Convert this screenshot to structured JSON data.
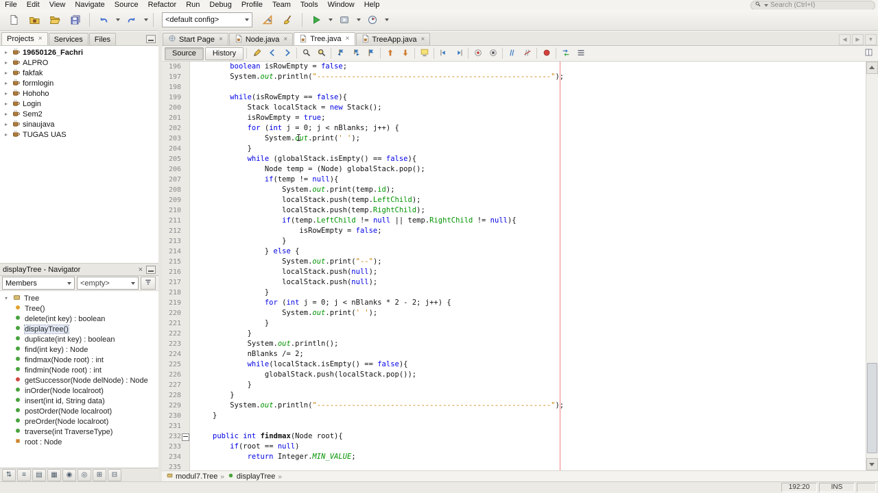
{
  "glyphs": {
    "close": "×",
    "expander_collapsed": "▸",
    "expander_expanded": "▾",
    "breadcrumb_sep": "»",
    "tab_scroll_left": "◀",
    "tab_scroll_right": "▶",
    "tab_list": "▼"
  },
  "menubar": {
    "items": [
      "File",
      "Edit",
      "View",
      "Navigate",
      "Source",
      "Refactor",
      "Run",
      "Debug",
      "Profile",
      "Team",
      "Tools",
      "Window",
      "Help"
    ],
    "search_placeholder": "Search (Ctrl+I)"
  },
  "main_toolbar": {
    "config_value": "<default config>",
    "items": [
      {
        "name": "new-file",
        "icon": "new-file"
      },
      {
        "name": "new-project",
        "icon": "new-project"
      },
      {
        "name": "open-project",
        "icon": "open-project"
      },
      {
        "name": "save-all",
        "icon": "save-all"
      },
      {
        "type": "sep"
      },
      {
        "name": "undo",
        "icon": "undo",
        "caret": true
      },
      {
        "name": "redo",
        "icon": "redo",
        "caret": true
      },
      {
        "type": "sep"
      },
      {
        "type": "config"
      },
      {
        "name": "build-project",
        "icon": "build"
      },
      {
        "name": "clean-build-project",
        "icon": "clean-build"
      },
      {
        "type": "sep"
      },
      {
        "name": "run-project",
        "icon": "run",
        "caret": true
      },
      {
        "name": "debug-project",
        "icon": "debug",
        "caret": true
      },
      {
        "name": "profile-project",
        "icon": "profile",
        "caret": true
      }
    ]
  },
  "left": {
    "tabs": [
      {
        "label": "Projects",
        "active": true,
        "closable": true
      },
      {
        "label": "Services"
      },
      {
        "label": "Files"
      }
    ],
    "projects": [
      {
        "label": "19650126_Fachri",
        "bold": true
      },
      {
        "label": "ALPRO"
      },
      {
        "label": "fakfak"
      },
      {
        "label": "formlogin"
      },
      {
        "label": "Hohoho"
      },
      {
        "label": "Login"
      },
      {
        "label": "Sem2"
      },
      {
        "label": "sinaujava"
      },
      {
        "label": "TUGAS UAS"
      }
    ],
    "navigator": {
      "title": "displayTree - Navigator",
      "members_label": "Members",
      "filter_value": "<empty>",
      "root_label": "Tree",
      "members": [
        {
          "kind": "constructor",
          "label": "Tree()"
        },
        {
          "kind": "method",
          "label": "delete(int key) : boolean"
        },
        {
          "kind": "method",
          "label": "displayTree()",
          "selected": true
        },
        {
          "kind": "method",
          "label": "duplicate(int key) : boolean"
        },
        {
          "kind": "method",
          "label": "find(int key) : Node"
        },
        {
          "kind": "method",
          "label": "findmax(Node root) : int"
        },
        {
          "kind": "method",
          "label": "findmin(Node root) : int"
        },
        {
          "kind": "method-private",
          "label": "getSuccessor(Node delNode) : Node"
        },
        {
          "kind": "method",
          "label": "inOrder(Node localroot)"
        },
        {
          "kind": "method",
          "label": "insert(int id, String data)"
        },
        {
          "kind": "method",
          "label": "postOrder(Node localroot)"
        },
        {
          "kind": "method",
          "label": "preOrder(Node localroot)"
        },
        {
          "kind": "method",
          "label": "traverse(int TraverseType)"
        },
        {
          "kind": "field",
          "label": "root : Node"
        }
      ],
      "toolbar": [
        {
          "name": "sort-by-name",
          "glyph": "⇅"
        },
        {
          "name": "sort-by-source",
          "glyph": "≡"
        },
        {
          "name": "show-inherited",
          "glyph": "▤"
        },
        {
          "name": "show-fields",
          "glyph": "▦"
        },
        {
          "name": "show-statics",
          "glyph": "◉"
        },
        {
          "name": "show-non-public",
          "glyph": "◎"
        },
        {
          "name": "expand-all",
          "glyph": "⊞"
        },
        {
          "name": "collapse-all",
          "glyph": "⊟"
        }
      ]
    }
  },
  "editor": {
    "tabs": [
      {
        "label": "Start Page",
        "icon": "start-page"
      },
      {
        "label": "Node.java",
        "icon": "java-file"
      },
      {
        "label": "Tree.java",
        "icon": "java-file",
        "active": true
      },
      {
        "label": "TreeApp.java",
        "icon": "java-file"
      }
    ],
    "source_label": "Source",
    "history_label": "History",
    "toolbar_items": [
      {
        "name": "last-edit-location",
        "icon": "last-edit"
      },
      {
        "name": "back",
        "icon": "nav-back"
      },
      {
        "name": "forward",
        "icon": "nav-forward"
      },
      {
        "type": "sep"
      },
      {
        "name": "find-selection",
        "icon": "find"
      },
      {
        "name": "incremental-search",
        "icon": "find-highlight"
      },
      {
        "type": "sep"
      },
      {
        "name": "previous-bookmark",
        "icon": "bookmark-prev"
      },
      {
        "name": "next-bookmark",
        "icon": "bookmark-next"
      },
      {
        "name": "toggle-bookmark",
        "icon": "bookmark"
      },
      {
        "type": "sep"
      },
      {
        "name": "previous-occurrence",
        "icon": "occ-up"
      },
      {
        "name": "next-occurrence",
        "icon": "occ-down"
      },
      {
        "type": "sep"
      },
      {
        "name": "toggle-highlight-search",
        "icon": "highlight"
      },
      {
        "type": "sep"
      },
      {
        "name": "shift-line-left",
        "icon": "shift-left"
      },
      {
        "name": "shift-line-right",
        "icon": "shift-right"
      },
      {
        "type": "sep"
      },
      {
        "name": "start-macro-recording",
        "icon": "macro-start"
      },
      {
        "name": "stop-macro-recording",
        "icon": "macro-stop"
      },
      {
        "type": "sep"
      },
      {
        "name": "comment",
        "icon": "comment"
      },
      {
        "name": "uncomment",
        "icon": "uncomment"
      },
      {
        "type": "sep"
      },
      {
        "name": "insert-profiling-point",
        "icon": "profiling-point"
      },
      {
        "type": "sep"
      },
      {
        "name": "diff",
        "icon": "diff"
      },
      {
        "name": "inspect-members",
        "icon": "list"
      }
    ],
    "breadcrumb": [
      {
        "icon": "class",
        "label": "modul7.Tree"
      },
      {
        "icon": "method",
        "label": "displayTree"
      }
    ],
    "lines": [
      {
        "n": 196,
        "t": [
          [
            "p",
            "    "
          ],
          [
            "k",
            "boolean"
          ],
          [
            "p",
            " isRowEmpty = "
          ],
          [
            "k",
            "false"
          ],
          [
            "p",
            ";"
          ]
        ]
      },
      {
        "n": 197,
        "t": [
          [
            "p",
            "    System."
          ],
          [
            "t",
            "out"
          ],
          [
            "p",
            ".println("
          ],
          [
            "s",
            "\"------------------------------------------------------\""
          ],
          [
            "p",
            ");"
          ]
        ]
      },
      {
        "n": 198,
        "t": []
      },
      {
        "n": 199,
        "t": [
          [
            "p",
            "    "
          ],
          [
            "k",
            "while"
          ],
          [
            "p",
            "(isRowEmpty == "
          ],
          [
            "k",
            "false"
          ],
          [
            "p",
            "){"
          ]
        ]
      },
      {
        "n": 200,
        "t": [
          [
            "p",
            "        Stack localStack = "
          ],
          [
            "k",
            "new"
          ],
          [
            "p",
            " Stack();"
          ]
        ]
      },
      {
        "n": 201,
        "t": [
          [
            "p",
            "        isRowEmpty = "
          ],
          [
            "k",
            "true"
          ],
          [
            "p",
            ";"
          ]
        ]
      },
      {
        "n": 202,
        "t": [
          [
            "p",
            "        "
          ],
          [
            "k",
            "for"
          ],
          [
            "p",
            " ("
          ],
          [
            "k",
            "int"
          ],
          [
            "p",
            " j = 0; j < nBlanks; j++) {"
          ]
        ]
      },
      {
        "n": 203,
        "t": [
          [
            "p",
            "            System."
          ],
          [
            "t",
            "out"
          ],
          [
            "p",
            ".print("
          ],
          [
            "s",
            "' '"
          ],
          [
            "p",
            ");"
          ]
        ]
      },
      {
        "n": 204,
        "t": [
          [
            "p",
            "        }"
          ]
        ]
      },
      {
        "n": 205,
        "t": [
          [
            "p",
            "        "
          ],
          [
            "k",
            "while"
          ],
          [
            "p",
            " (globalStack.isEmpty() == "
          ],
          [
            "k",
            "false"
          ],
          [
            "p",
            "){"
          ]
        ]
      },
      {
        "n": 206,
        "t": [
          [
            "p",
            "            Node temp = (Node) globalStack.pop();"
          ]
        ]
      },
      {
        "n": 207,
        "t": [
          [
            "p",
            "            "
          ],
          [
            "k",
            "if"
          ],
          [
            "p",
            "(temp != "
          ],
          [
            "k",
            "null"
          ],
          [
            "p",
            "){"
          ]
        ]
      },
      {
        "n": 208,
        "t": [
          [
            "p",
            "                System."
          ],
          [
            "t",
            "out"
          ],
          [
            "p",
            ".print(temp."
          ],
          [
            "f",
            "id"
          ],
          [
            "p",
            ");"
          ]
        ]
      },
      {
        "n": 209,
        "t": [
          [
            "p",
            "                localStack.push(temp."
          ],
          [
            "f",
            "LeftChild"
          ],
          [
            "p",
            ");"
          ]
        ]
      },
      {
        "n": 210,
        "t": [
          [
            "p",
            "                localStack.push(temp."
          ],
          [
            "f",
            "RightChild"
          ],
          [
            "p",
            ");"
          ]
        ]
      },
      {
        "n": 211,
        "t": [
          [
            "p",
            "                "
          ],
          [
            "k",
            "if"
          ],
          [
            "p",
            "(temp."
          ],
          [
            "f",
            "LeftChild"
          ],
          [
            "p",
            " != "
          ],
          [
            "k",
            "null"
          ],
          [
            "p",
            " || temp."
          ],
          [
            "f",
            "RightChild"
          ],
          [
            "p",
            " != "
          ],
          [
            "k",
            "null"
          ],
          [
            "p",
            "){"
          ]
        ]
      },
      {
        "n": 212,
        "t": [
          [
            "p",
            "                    isRowEmpty = "
          ],
          [
            "k",
            "false"
          ],
          [
            "p",
            ";"
          ]
        ]
      },
      {
        "n": 213,
        "t": [
          [
            "p",
            "                }"
          ]
        ]
      },
      {
        "n": 214,
        "t": [
          [
            "p",
            "            } "
          ],
          [
            "k",
            "else"
          ],
          [
            "p",
            " {"
          ]
        ]
      },
      {
        "n": 215,
        "t": [
          [
            "p",
            "                System."
          ],
          [
            "t",
            "out"
          ],
          [
            "p",
            ".print("
          ],
          [
            "s",
            "\"--\""
          ],
          [
            "p",
            ");"
          ]
        ]
      },
      {
        "n": 216,
        "t": [
          [
            "p",
            "                localStack.push("
          ],
          [
            "k",
            "null"
          ],
          [
            "p",
            ");"
          ]
        ]
      },
      {
        "n": 217,
        "t": [
          [
            "p",
            "                localStack.push("
          ],
          [
            "k",
            "null"
          ],
          [
            "p",
            ");"
          ]
        ]
      },
      {
        "n": 218,
        "t": [
          [
            "p",
            "            }"
          ]
        ]
      },
      {
        "n": 219,
        "t": [
          [
            "p",
            "            "
          ],
          [
            "k",
            "for"
          ],
          [
            "p",
            " ("
          ],
          [
            "k",
            "int"
          ],
          [
            "p",
            " j = 0; j < nBlanks * 2 - 2; j++) {"
          ]
        ]
      },
      {
        "n": 220,
        "t": [
          [
            "p",
            "                System."
          ],
          [
            "t",
            "out"
          ],
          [
            "p",
            ".print("
          ],
          [
            "s",
            "' '"
          ],
          [
            "p",
            ");"
          ]
        ]
      },
      {
        "n": 221,
        "t": [
          [
            "p",
            "            }"
          ]
        ]
      },
      {
        "n": 222,
        "t": [
          [
            "p",
            "        }"
          ]
        ]
      },
      {
        "n": 223,
        "t": [
          [
            "p",
            "        System."
          ],
          [
            "t",
            "out"
          ],
          [
            "p",
            ".println();"
          ]
        ]
      },
      {
        "n": 224,
        "t": [
          [
            "p",
            "        nBlanks /= 2;"
          ]
        ]
      },
      {
        "n": 225,
        "t": [
          [
            "p",
            "        "
          ],
          [
            "k",
            "while"
          ],
          [
            "p",
            "(localStack.isEmpty() == "
          ],
          [
            "k",
            "false"
          ],
          [
            "p",
            "){"
          ]
        ]
      },
      {
        "n": 226,
        "t": [
          [
            "p",
            "            globalStack.push(localStack.pop());"
          ]
        ]
      },
      {
        "n": 227,
        "t": [
          [
            "p",
            "        }"
          ]
        ]
      },
      {
        "n": 228,
        "t": [
          [
            "p",
            "    }"
          ]
        ]
      },
      {
        "n": 229,
        "t": [
          [
            "p",
            "    System."
          ],
          [
            "t",
            "out"
          ],
          [
            "p",
            ".println("
          ],
          [
            "s",
            "\"------------------------------------------------------\""
          ],
          [
            "p",
            ");"
          ]
        ]
      },
      {
        "n": 230,
        "t": [
          [
            "p",
            "}"
          ]
        ]
      },
      {
        "n": 231,
        "t": []
      },
      {
        "n": 232,
        "fold": "minus",
        "t": [
          [
            "k",
            "public"
          ],
          [
            "p",
            " "
          ],
          [
            "k",
            "int"
          ],
          [
            "p",
            " "
          ],
          [
            "m",
            "findmax"
          ],
          [
            "p",
            "(Node root){"
          ]
        ]
      },
      {
        "n": 233,
        "t": [
          [
            "p",
            "    "
          ],
          [
            "k",
            "if"
          ],
          [
            "p",
            "(root == "
          ],
          [
            "k",
            "null"
          ],
          [
            "p",
            ")"
          ]
        ]
      },
      {
        "n": 234,
        "t": [
          [
            "p",
            "        "
          ],
          [
            "k",
            "return"
          ],
          [
            "p",
            " Integer."
          ],
          [
            "t",
            "MIN_VALUE"
          ],
          [
            "p",
            ";"
          ]
        ]
      },
      {
        "n": 235,
        "t": []
      }
    ]
  },
  "statusbar": {
    "caret": "192:20",
    "mode": "INS"
  }
}
